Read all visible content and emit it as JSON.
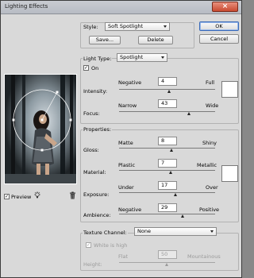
{
  "window": {
    "title": "Lighting Effects",
    "close_glyph": "×"
  },
  "buttons": {
    "ok": "OK",
    "cancel": "Cancel",
    "save": "Save...",
    "delete": "Delete"
  },
  "style": {
    "label": "Style:",
    "value": "Soft Spotlight"
  },
  "light": {
    "label": "Light Type:",
    "value": "Spotlight",
    "on_label": "On",
    "on_checked": true
  },
  "intensity": {
    "label": "Intensity:",
    "min": "Negative",
    "max": "Full",
    "value": "4"
  },
  "focus": {
    "label": "Focus:",
    "min": "Narrow",
    "max": "Wide",
    "value": "43"
  },
  "properties": {
    "label": "Properties:",
    "gloss": {
      "label": "Gloss:",
      "min": "Matte",
      "max": "Shiny",
      "value": "8"
    },
    "material": {
      "label": "Material:",
      "min": "Plastic",
      "max": "Metallic",
      "value": "7"
    },
    "exposure": {
      "label": "Exposure:",
      "min": "Under",
      "max": "Over",
      "value": "17"
    },
    "ambience": {
      "label": "Ambience:",
      "min": "Negative",
      "max": "Positive",
      "value": "29"
    }
  },
  "texture": {
    "label": "Texture Channel:",
    "value": "None",
    "white_is_high_label": "White is high",
    "white_is_high_checked": true,
    "height": {
      "label": "Height:",
      "min": "Flat",
      "max": "Mountainous",
      "value": "50"
    }
  },
  "preview": {
    "label": "Preview",
    "checked": true
  },
  "icons": {
    "bulb": "lightbulb-icon",
    "trash": "trash-icon"
  }
}
